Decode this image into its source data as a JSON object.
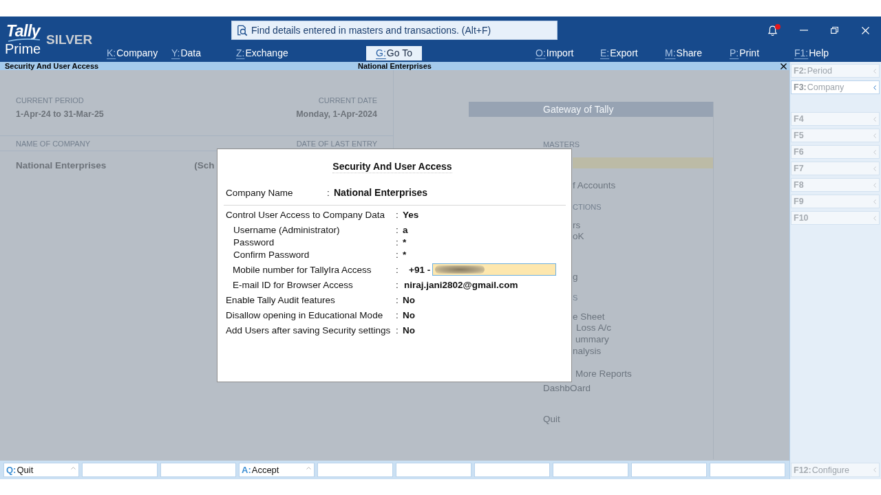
{
  "header": {
    "logo": {
      "brand": "Tally",
      "product": "Prime",
      "edition": "SILVER"
    },
    "search": {
      "placeholder": "Find details entered in masters and transactions. (Alt+F)"
    },
    "notifications": {
      "unread": true
    },
    "menu": [
      {
        "key": "K:",
        "label": "Company",
        "selected": false
      },
      {
        "key": "Y:",
        "label": "Data",
        "selected": false
      },
      {
        "key": "Z:",
        "label": "Exchange",
        "selected": false
      },
      {
        "key": "G:",
        "label": "Go To",
        "selected": true
      },
      {
        "key": "O:",
        "label": "Import",
        "selected": false
      },
      {
        "key": "E:",
        "label": "Export",
        "selected": false
      },
      {
        "key": "M:",
        "label": "Share",
        "selected": false
      },
      {
        "key": "P:",
        "label": "Print",
        "selected": false
      },
      {
        "key": "F1:",
        "label": "Help",
        "selected": false
      }
    ]
  },
  "title_bar": {
    "title": "Security And User Access",
    "company": "National Enterprises"
  },
  "company_panel": {
    "period_label": "CURRENT PERIOD",
    "period": "1-Apr-24 to 31-Mar-25",
    "date_label": "CURRENT DATE",
    "date": "Monday, 1-Apr-2024",
    "name_label": "NAME OF COMPANY",
    "last_entry_label": "DATE OF LAST ENTRY",
    "company": "National Enterprises",
    "column_2": "(Sch"
  },
  "gateway": {
    "title": "Gateway of Tally",
    "items": [
      {
        "kind": "heading",
        "text": "MASTERS"
      },
      {
        "kind": "highlight"
      },
      {
        "kind": "item",
        "text": "f Accounts"
      },
      {
        "kind": "heading",
        "text": "CTIONS"
      },
      {
        "kind": "item",
        "text": "rs"
      },
      {
        "kind": "item",
        "text": "oK"
      },
      {
        "kind": "item",
        "text": "g"
      },
      {
        "kind": "heading",
        "text": "S"
      },
      {
        "kind": "item",
        "text": "e Sheet"
      },
      {
        "kind": "item",
        "text": "Loss A/c"
      },
      {
        "kind": "item",
        "text": "ummary"
      },
      {
        "kind": "item",
        "text": "nalysis"
      },
      {
        "kind": "item",
        "text": "More Reports"
      },
      {
        "kind": "item",
        "text": "DashbOard"
      },
      {
        "kind": "item",
        "text": "Quit"
      }
    ]
  },
  "dialog": {
    "title": "Security And User Access",
    "company": {
      "label": "Company Name",
      "colon": ":",
      "value": "National Enterprises"
    },
    "fields": [
      {
        "kind": "option",
        "label": "Control User Access to Company Data",
        "colon": ":",
        "value": "Yes"
      },
      {
        "kind": "credential",
        "label": "Username (Administrator)",
        "colon": ":",
        "value": "a"
      },
      {
        "kind": "credential",
        "label": "Password",
        "colon": ":",
        "value": "*"
      },
      {
        "kind": "credential",
        "label": "Confirm Password",
        "colon": ":",
        "value": "*"
      },
      {
        "kind": "phone",
        "label": "Mobile number for TallyIra Access",
        "colon": ":",
        "prefix": "+91 -",
        "focused": true,
        "redacted": true
      },
      {
        "kind": "contact",
        "label": "E-mail ID for Browser Access",
        "colon": ":",
        "value": "niraj.jani2802@gmail.com"
      },
      {
        "kind": "option",
        "label": "Enable Tally Audit features",
        "colon": ":",
        "value": "No"
      },
      {
        "kind": "option",
        "label": "Disallow opening in Educational Mode",
        "colon": ":",
        "value": "No"
      },
      {
        "kind": "option",
        "label": "Add Users after saving Security settings",
        "colon": ":",
        "value": "No"
      }
    ]
  },
  "sidebar": {
    "groups": [
      {
        "buttons": [
          {
            "key": "F2:",
            "label": "Period",
            "selected": false
          },
          {
            "key": "F3:",
            "label": "Company",
            "selected": true
          }
        ]
      },
      {
        "buttons": [
          {
            "key": "F4",
            "selected": false
          },
          {
            "key": "F5",
            "selected": false
          },
          {
            "key": "F6",
            "selected": false
          },
          {
            "key": "F7",
            "selected": false
          },
          {
            "key": "F8",
            "selected": false
          },
          {
            "key": "F9",
            "selected": false
          },
          {
            "key": "F10",
            "selected": false
          }
        ]
      }
    ],
    "configure": {
      "key": "F12:",
      "label": "Configure"
    }
  },
  "button_bar": {
    "buttons": [
      {
        "kind": "action",
        "key": "Q:",
        "label": "Quit"
      },
      {
        "kind": "blank"
      },
      {
        "kind": "blank"
      },
      {
        "kind": "action",
        "key": "A:",
        "label": "Accept"
      },
      {
        "kind": "blank"
      },
      {
        "kind": "blank"
      },
      {
        "kind": "blank"
      },
      {
        "kind": "blank"
      },
      {
        "kind": "blank"
      },
      {
        "kind": "blank"
      }
    ]
  }
}
